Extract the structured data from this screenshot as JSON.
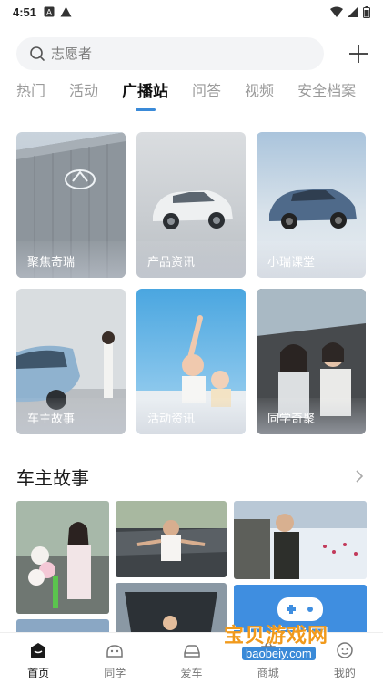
{
  "status_bar": {
    "time": "4:51"
  },
  "search": {
    "placeholder": "志愿者"
  },
  "tabs": [
    {
      "label": "热门",
      "active": false
    },
    {
      "label": "活动",
      "active": false
    },
    {
      "label": "广播站",
      "active": true
    },
    {
      "label": "问答",
      "active": false
    },
    {
      "label": "视频",
      "active": false
    },
    {
      "label": "安全档案",
      "active": false
    }
  ],
  "categories": [
    {
      "label": "聚焦奇瑞"
    },
    {
      "label": "产品资讯"
    },
    {
      "label": "小瑞课堂"
    },
    {
      "label": "车主故事"
    },
    {
      "label": "活动资讯"
    },
    {
      "label": "同学奇聚"
    }
  ],
  "section": {
    "title": "车主故事"
  },
  "bottom_nav": [
    {
      "label": "首页",
      "active": true
    },
    {
      "label": "同学",
      "active": false
    },
    {
      "label": "爱车",
      "active": false
    },
    {
      "label": "商城",
      "active": false
    },
    {
      "label": "我的",
      "active": false
    }
  ],
  "watermark": {
    "title": "宝贝游戏网",
    "url": "baobeiy.com"
  },
  "colors": {
    "accent": "#3a8ad8",
    "watermark": "#f19a1c"
  }
}
